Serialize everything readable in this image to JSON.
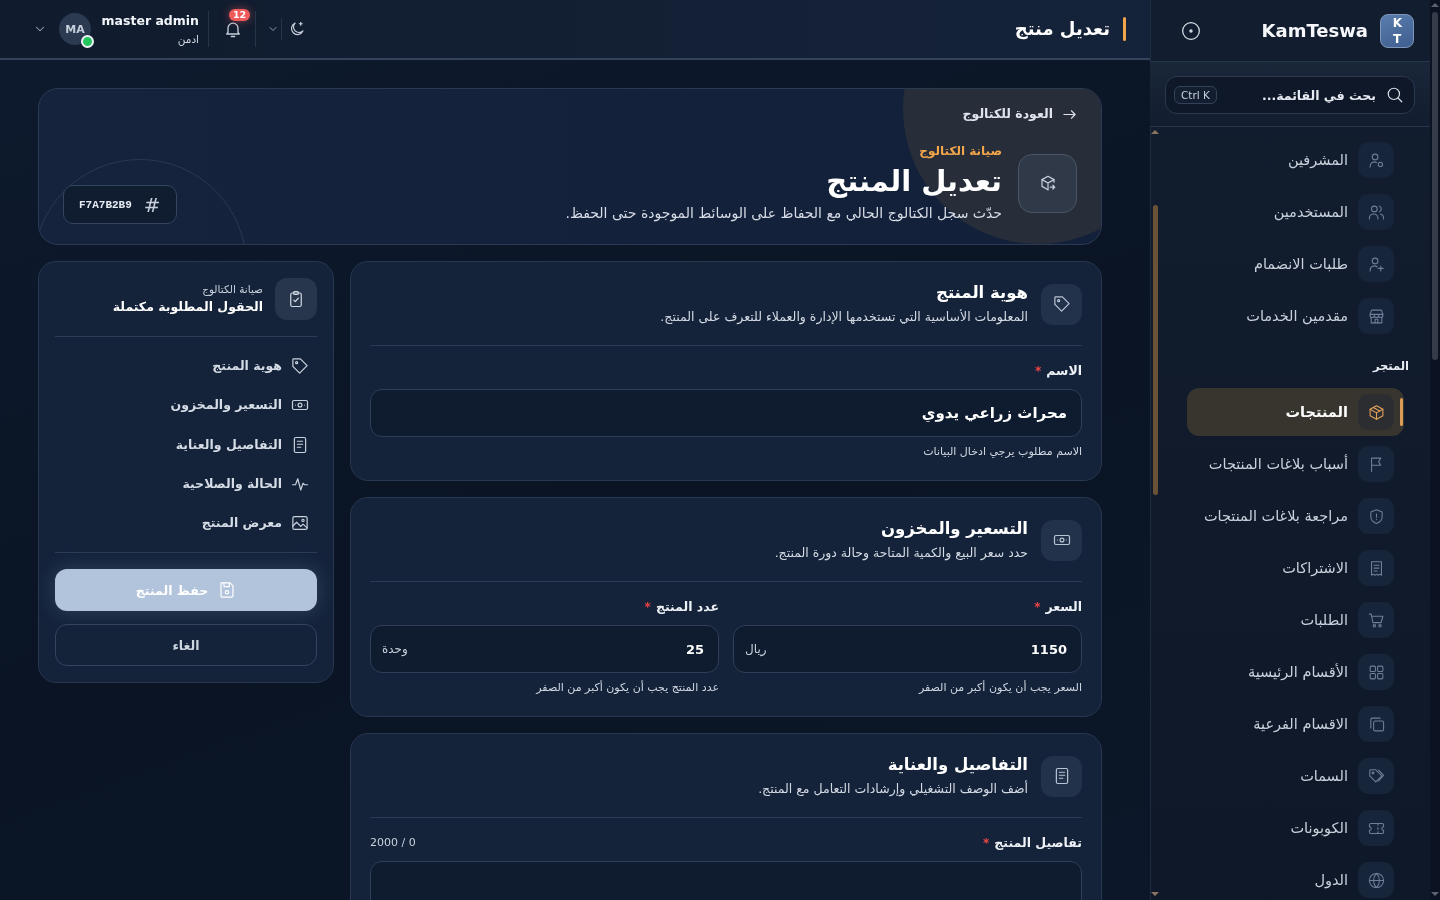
{
  "sidebar": {
    "logo_text": "KT",
    "brand": "KamTeswa",
    "search": {
      "placeholder": "بحث في القائمة...",
      "shortcut": "Ctrl K"
    },
    "groups": [
      {
        "items": [
          {
            "label": "المشرفين",
            "selected": false
          },
          {
            "label": "المستخدمين",
            "selected": false
          },
          {
            "label": "طلبات الانضمام",
            "selected": false
          },
          {
            "label": "مقدمين الخدمات",
            "selected": false
          }
        ]
      },
      {
        "title": "المتجر",
        "items": [
          {
            "label": "المنتجات",
            "selected": true
          },
          {
            "label": "أسباب بلاغات المنتجات",
            "selected": false
          },
          {
            "label": "مراجعة بلاغات المنتجات",
            "selected": false
          },
          {
            "label": "الاشتراكات",
            "selected": false
          },
          {
            "label": "الطلبات",
            "selected": false
          },
          {
            "label": "الأقسام الرئيسية",
            "selected": false
          },
          {
            "label": "الاقسام الفرعية",
            "selected": false
          },
          {
            "label": "السمات",
            "selected": false
          },
          {
            "label": "الكوبونات",
            "selected": false
          },
          {
            "label": "الدول",
            "selected": false
          }
        ]
      }
    ]
  },
  "topbar": {
    "title": "تعديل منتج",
    "user": {
      "initials": "MA",
      "name": "master admin",
      "role": "ادمن",
      "online": true
    },
    "notifications": {
      "count": "12"
    }
  },
  "header": {
    "back_link": "العودة للكتالوج",
    "eyebrow": "صيانة الكتالوج",
    "title": "تعديل المنتج",
    "description": "حدّث سجل الكتالوج الحالي مع الحفاظ على الوسائط الموجودة حتى الحفظ.",
    "badge": {
      "symbol": "#",
      "code": "F7A7B2B9"
    }
  },
  "sections": [
    {
      "title": "هوية المنتج",
      "description": "المعلومات الأساسية التي تستخدمها الإدارة والعملاء للتعرف على المنتج.",
      "fields": [
        {
          "kind": "text",
          "label": "الاسم",
          "required_mark": "*",
          "value": "محراث زراعي يدوي",
          "helper": "الاسم مطلوب يرجي ادخال البيانات"
        }
      ]
    },
    {
      "title": "التسعير والمخزون",
      "description": "حدد سعر البيع والكمية المتاحة وحالة دورة المنتج.",
      "fields": [
        {
          "kind": "number",
          "label": "السعر",
          "required_mark": "*",
          "value": "1150",
          "suffix": "ريال",
          "helper": "السعر يجب أن يكون أكبر من الصفر"
        },
        {
          "kind": "number",
          "label": "عدد المنتج",
          "required_mark": "*",
          "value": "25",
          "suffix": "وحدة",
          "helper": "عدد المنتج يجب أن يكون أكبر من الصفر"
        }
      ]
    },
    {
      "title": "التفاصيل والعناية",
      "description": "أضف الوصف التشغيلي وإرشادات التعامل مع المنتج.",
      "fields": [
        {
          "kind": "textarea",
          "label": "تفاصيل المنتج",
          "required_mark": "*",
          "counter": "2000 / 0"
        }
      ]
    }
  ],
  "summary": {
    "eyebrow": "صيانة الكتالوج",
    "title": "الحقول المطلوبة مكتملة",
    "links": [
      "هوية المنتج",
      "التسعير والمخزون",
      "التفاصيل والعناية",
      "الحالة والصلاحية",
      "معرض المنتج"
    ],
    "buttons": [
      {
        "label": "حفظ المنتج",
        "kind": "primary",
        "disabled": true
      },
      {
        "label": "الغاء",
        "kind": "secondary",
        "disabled": false
      }
    ]
  }
}
